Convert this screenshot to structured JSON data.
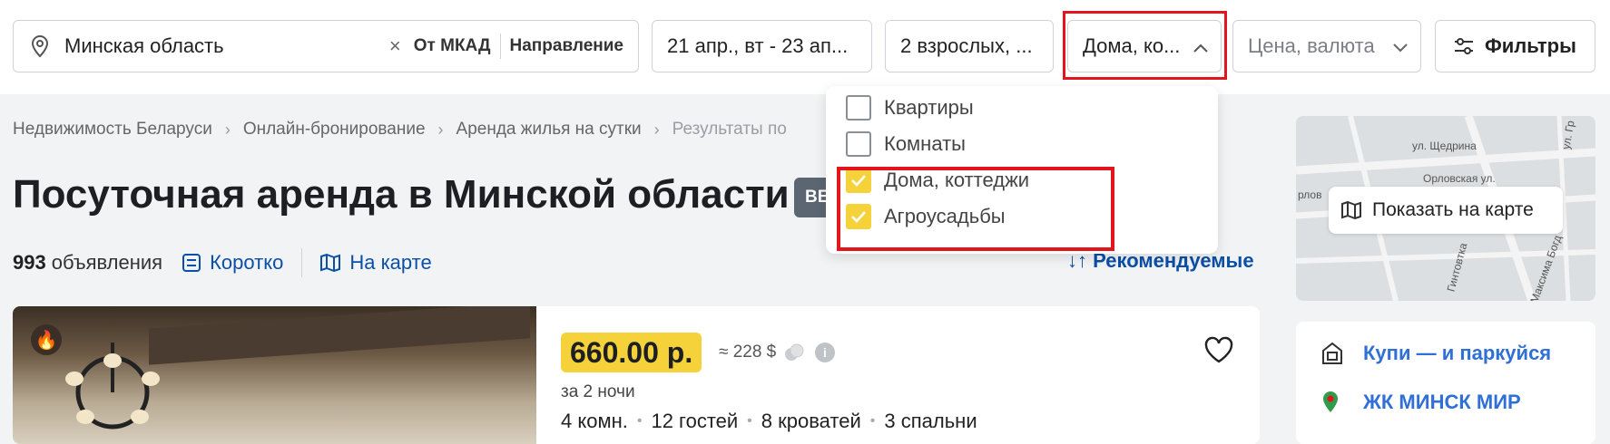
{
  "search": {
    "location": "Минская область",
    "clear": "×",
    "from_mkad": "От МКАД",
    "direction": "Направление",
    "dates": "21 апр., вт - 23 ап...",
    "guests": "2 взрослых, ...",
    "property_type": "Дома, ко...",
    "price_placeholder": "Цена, валюта",
    "filters": "Фильтры"
  },
  "dropdown": {
    "options": [
      {
        "label": "Квартиры",
        "checked": false
      },
      {
        "label": "Комнаты",
        "checked": false
      },
      {
        "label": "Дома, коттеджи",
        "checked": true
      },
      {
        "label": "Агроусадьбы",
        "checked": true
      }
    ]
  },
  "breadcrumb": [
    "Недвижимость Беларуси",
    "Онлайн-бронирование",
    "Аренда жилья на сутки",
    "Результаты по"
  ],
  "page": {
    "title": "Посуточная аренда в Минской области",
    "badge": "ВЕ",
    "count": "993",
    "count_label": "объявления",
    "short_view": "Коротко",
    "on_map": "На карте",
    "sort": "↓↑ Рекомендуемые"
  },
  "listing": {
    "price": "660.00 р.",
    "usd": "≈ 228 $",
    "info": "i",
    "nights": "за 2 ночи",
    "specs": [
      "4 комн.",
      "12 гостей",
      "8 кроватей",
      "3 спальни"
    ]
  },
  "map": {
    "show_on_map": "Показать на карте",
    "streets": [
      "ул. Щедрина",
      "Орловская ул.",
      "рлов",
      "ул. Гр",
      "Максима Богд",
      "Гинтовтка"
    ]
  },
  "promo": {
    "items": [
      "Купи — и паркуйся",
      "ЖК МИНСК МИР"
    ]
  },
  "colors": {
    "accent_blue": "#0a4fa8",
    "highlight_red": "#e3141c",
    "price_yellow": "#f6d23a"
  }
}
